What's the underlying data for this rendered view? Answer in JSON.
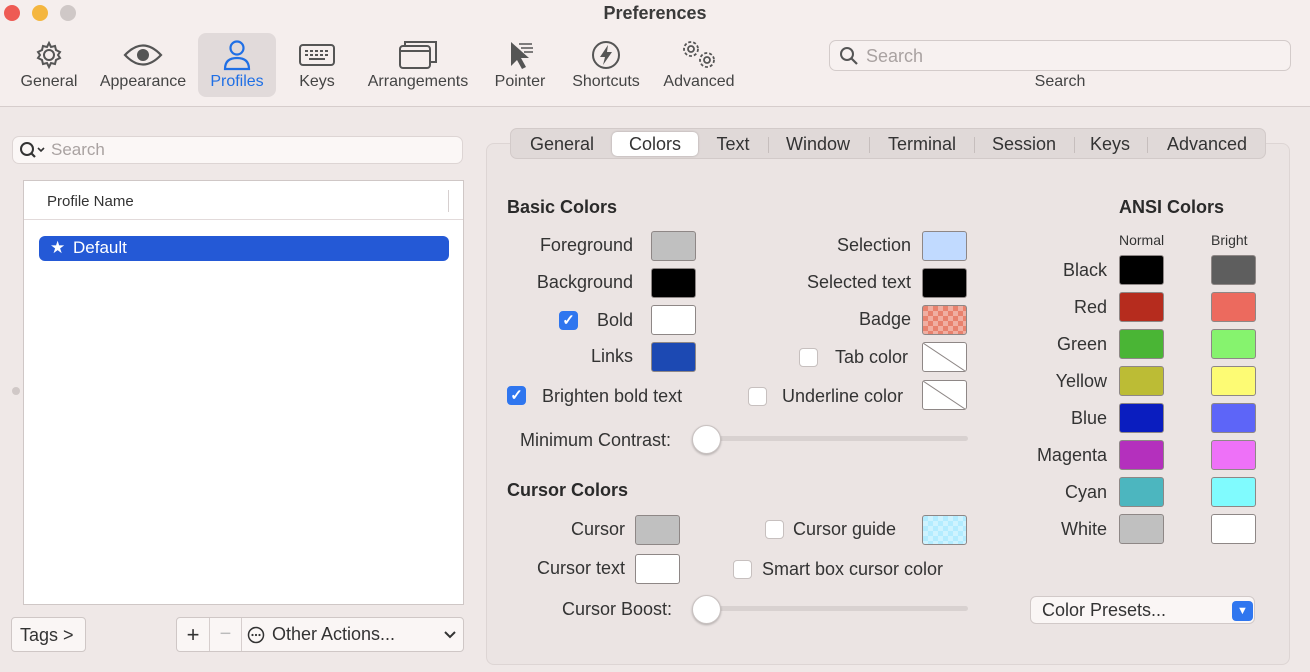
{
  "window": {
    "title": "Preferences"
  },
  "toolbar": {
    "items": [
      {
        "label": "General",
        "icon": "gear-icon"
      },
      {
        "label": "Appearance",
        "icon": "eye-icon"
      },
      {
        "label": "Profiles",
        "icon": "person-icon"
      },
      {
        "label": "Keys",
        "icon": "keyboard-icon"
      },
      {
        "label": "Arrangements",
        "icon": "windows-icon"
      },
      {
        "label": "Pointer",
        "icon": "pointer-icon"
      },
      {
        "label": "Shortcuts",
        "icon": "lightning-icon"
      },
      {
        "label": "Advanced",
        "icon": "gears-icon"
      }
    ],
    "search": {
      "placeholder": "Search",
      "caption": "Search"
    }
  },
  "profiles": {
    "search_placeholder": "Search",
    "column_header": "Profile Name",
    "rows": [
      {
        "name": "Default",
        "default": true
      }
    ],
    "tags_button": "Tags >",
    "add_label": "+",
    "remove_label": "−",
    "other_actions": "Other Actions...",
    "other_actions_icon": "ellipsis-circle-icon"
  },
  "tabs": {
    "items": [
      "General",
      "Colors",
      "Text",
      "Window",
      "Terminal",
      "Session",
      "Keys",
      "Advanced"
    ],
    "active": "Colors"
  },
  "basic_colors": {
    "title": "Basic Colors",
    "foreground": {
      "label": "Foreground",
      "color": "#c0c0c0"
    },
    "background": {
      "label": "Background",
      "color": "#000000"
    },
    "bold": {
      "label": "Bold",
      "color": "#ffffff",
      "checked": true
    },
    "links": {
      "label": "Links",
      "color": "#1c49b3"
    },
    "selection": {
      "label": "Selection",
      "color": "#c1daff"
    },
    "selected_text": {
      "label": "Selected text",
      "color": "#000000"
    },
    "badge": {
      "label": "Badge",
      "color": "#e8826e"
    },
    "tab_color": {
      "label": "Tab color",
      "checked": false
    },
    "underline_color": {
      "label": "Underline color",
      "checked": false
    },
    "brighten_bold": {
      "label": "Brighten bold text",
      "checked": true
    },
    "minimum_contrast": {
      "label": "Minimum Contrast:",
      "value": 0
    }
  },
  "cursor_colors": {
    "title": "Cursor Colors",
    "cursor": {
      "label": "Cursor",
      "color": "#c0c0c0"
    },
    "cursor_text": {
      "label": "Cursor text",
      "color": "#ffffff"
    },
    "cursor_guide": {
      "label": "Cursor guide",
      "checked": false,
      "color": "#b3ecff"
    },
    "smart_box": {
      "label": "Smart box cursor color",
      "checked": false
    },
    "cursor_boost": {
      "label": "Cursor Boost:",
      "value": 0
    }
  },
  "ansi": {
    "title": "ANSI Colors",
    "normal_header": "Normal",
    "bright_header": "Bright",
    "rows": [
      {
        "name": "Black",
        "normal": "#000000",
        "bright": "#5e5e5e"
      },
      {
        "name": "Red",
        "normal": "#b62c1e",
        "bright": "#ec6a5e"
      },
      {
        "name": "Green",
        "normal": "#4ab535",
        "bright": "#86f36e"
      },
      {
        "name": "Yellow",
        "normal": "#bcbc35",
        "bright": "#fdfb74"
      },
      {
        "name": "Blue",
        "normal": "#0a1dbf",
        "bright": "#5d65f8"
      },
      {
        "name": "Magenta",
        "normal": "#b430bd",
        "bright": "#ee71f8"
      },
      {
        "name": "Cyan",
        "normal": "#4cb6bf",
        "bright": "#80fbfe"
      },
      {
        "name": "White",
        "normal": "#c0c0c0",
        "bright": "#ffffff"
      }
    ],
    "presets_label": "Color Presets..."
  }
}
